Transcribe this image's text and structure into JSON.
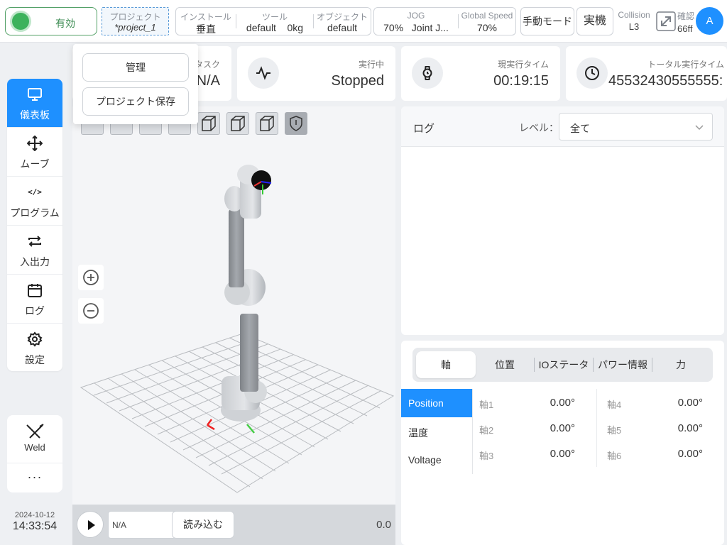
{
  "topbar": {
    "enable_label": "有効",
    "project": {
      "label": "プロジェクト",
      "value": "*project_1"
    },
    "install": {
      "label": "インストール",
      "value": "垂直"
    },
    "tool": {
      "label": "ツール",
      "value_name": "default",
      "value_weight": "0kg"
    },
    "object": {
      "label": "オブジェクト",
      "value": "default"
    },
    "jog": {
      "label": "JOG",
      "percent": "70%",
      "mode": "Joint J..."
    },
    "global_speed": {
      "label": "Global Speed",
      "value": "70%"
    },
    "manual_mode": "手動モード",
    "real_machine": "実機",
    "collision": {
      "label": "Collision",
      "value": "L3"
    },
    "confirm": {
      "label": "確認",
      "value": "66ff"
    },
    "avatar": "A"
  },
  "project_menu": {
    "manage": "管理",
    "save": "プロジェクト保存"
  },
  "nav": [
    {
      "label": "儀表板",
      "icon": "monitor-icon",
      "active": true
    },
    {
      "label": "ムーブ",
      "icon": "move-icon",
      "active": false
    },
    {
      "label": "プログラム",
      "icon": "code-icon",
      "active": false
    },
    {
      "label": "入出力",
      "icon": "io-icon",
      "active": false
    },
    {
      "label": "ログ",
      "icon": "calendar-icon",
      "active": false
    },
    {
      "label": "設定",
      "icon": "gear-icon",
      "active": false
    }
  ],
  "plugins": {
    "weld_label": "Weld",
    "more_label": "···"
  },
  "clock": {
    "date": "2024-10-12",
    "time": "14:33:54"
  },
  "cards": {
    "task": {
      "label": "タスク",
      "value": "N/A"
    },
    "running": {
      "label": "実行中",
      "value": "Stopped"
    },
    "current_time": {
      "label": "現実行タイム",
      "value": "00:19:15"
    },
    "total_time": {
      "label": "トータル実行タイム",
      "value": "45532430555555:"
    }
  },
  "viewer": {
    "program_name": "N/A",
    "load_button": "読み込む",
    "speed_value": "0.0"
  },
  "log": {
    "title": "ログ",
    "level_label": "レベル：",
    "level_value": "全て"
  },
  "axis_panel": {
    "tabs": [
      "軸",
      "位置",
      "IOステータ",
      "パワー情報",
      "力"
    ],
    "active_tab": 0,
    "side_tabs": [
      "Position",
      "温度",
      "Voltage"
    ],
    "active_side_tab": 0,
    "joints": [
      {
        "name": "軸1",
        "value": "0.00°"
      },
      {
        "name": "軸2",
        "value": "0.00°"
      },
      {
        "name": "軸3",
        "value": "0.00°"
      },
      {
        "name": "軸4",
        "value": "0.00°"
      },
      {
        "name": "軸5",
        "value": "0.00°"
      },
      {
        "name": "軸6",
        "value": "0.00°"
      }
    ]
  },
  "colors": {
    "accent": "#1e90ff",
    "enabled": "#3cb25c"
  }
}
